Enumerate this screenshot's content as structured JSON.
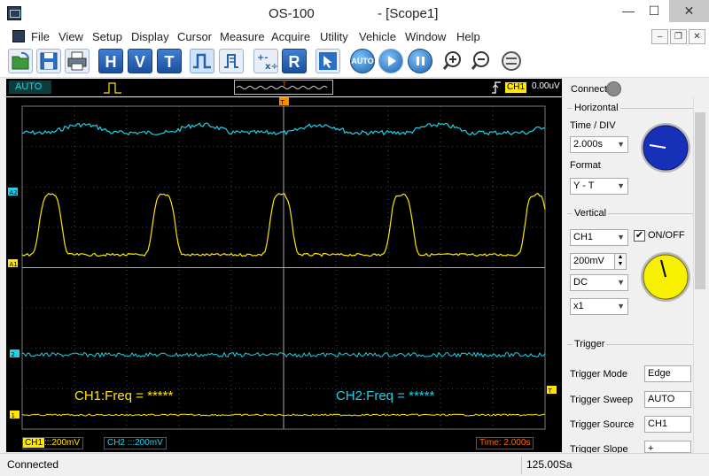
{
  "window": {
    "app_title": "OS-100",
    "doc_title": "- [Scope1]",
    "min": "—",
    "max": "☐",
    "close": "✕"
  },
  "menu": [
    "File",
    "View",
    "Setup",
    "Display",
    "Cursor",
    "Measure",
    "Acquire",
    "Utility",
    "Vehicle",
    "Window",
    "Help"
  ],
  "mdi": {
    "min": "–",
    "restore": "❐",
    "close": "✕"
  },
  "toolbar": {
    "open": "open-icon",
    "save": "save-icon",
    "print": "print-icon",
    "h": "H",
    "v": "V",
    "t": "T",
    "r": "R",
    "auto": "AUTO"
  },
  "strip": {
    "mode": "AUTO",
    "trig_channel": "CH1",
    "trig_level": "0.00uV"
  },
  "scope": {
    "marker_trigger": "T",
    "marker_a2": "A2",
    "marker_a1": "A1",
    "marker_2": "2",
    "marker_1": "1",
    "ch1_freq": "CH1:Freq = *****",
    "ch2_freq": "CH2:Freq = *****",
    "ch1_badge": "CH1",
    "ch1_scale": ":::200mV",
    "ch2_scale": "CH2 :::200mV",
    "time_scale": "Time: 2.000s",
    "colors": {
      "ch1": "#ffe500",
      "ch2": "#1fd0e8",
      "grid": "#7a7a7a",
      "trigger": "#ff8c00"
    }
  },
  "panel": {
    "connect": "Connect",
    "horizontal": {
      "title": "Horizontal",
      "time_div_label": "Time / DIV",
      "time_div": "2.000s",
      "format_label": "Format",
      "format": "Y - T"
    },
    "vertical": {
      "title": "Vertical",
      "channel": "CH1",
      "onoff": "ON/OFF",
      "volts": "200mV",
      "coupling": "DC",
      "probe": "x1"
    },
    "trigger": {
      "title": "Trigger",
      "mode_label": "Trigger Mode",
      "mode": "Edge",
      "sweep_label": "Trigger Sweep",
      "sweep": "AUTO",
      "source_label": "Trigger Source",
      "source": "CH1",
      "slope_label": "Trigger Slope",
      "slope": "+"
    }
  },
  "status": {
    "text": "Connected",
    "sample_rate": "125.00Sa"
  }
}
